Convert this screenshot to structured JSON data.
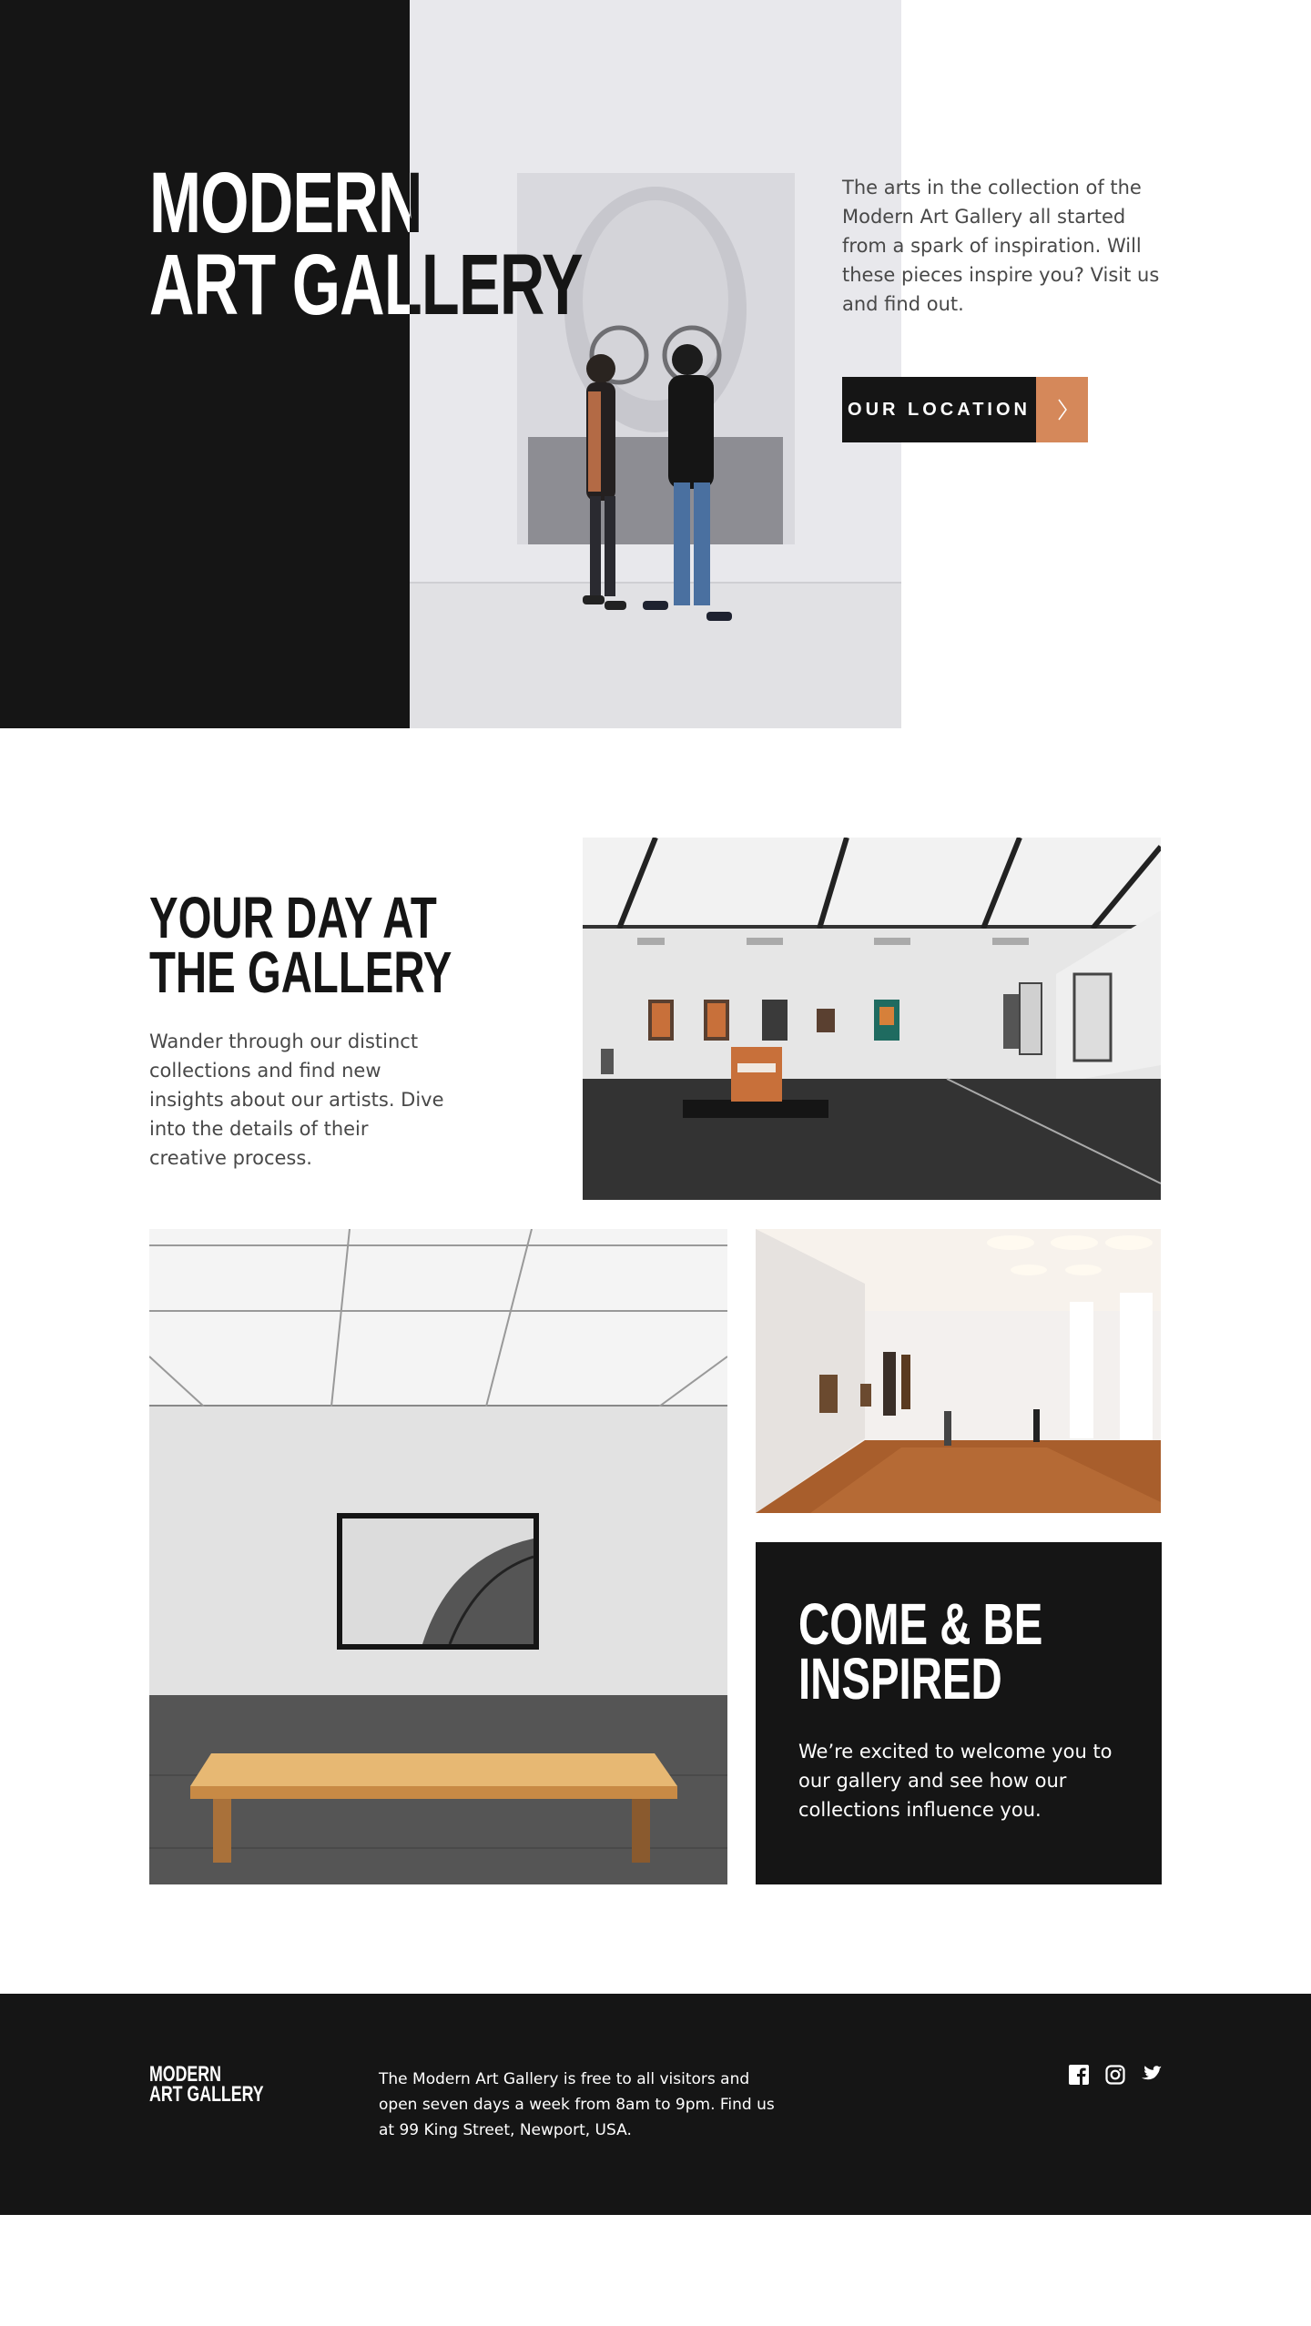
{
  "hero": {
    "title_line1": "Modern",
    "title_line2": "Art Gallery",
    "description": "The arts in the collection of the Modern Art Gallery all started from a spark of inspiration. Will these pieces inspire you? Visit us and find out.",
    "cta_label": "OUR LOCATION",
    "cta_icon": "chevron-right-icon"
  },
  "day_section": {
    "title_line1": "Your day at",
    "title_line2": "the gallery",
    "description": "Wander through our distinct collections and find new insights about our artists. Dive into the details of their creative process."
  },
  "inspired": {
    "title_line1": "Come & be",
    "title_line2": "inspired",
    "description": "We’re excited to welcome you to our gallery and see how our collections influence you."
  },
  "footer": {
    "logo_line1": "Modern",
    "logo_line2": "Art Gallery",
    "info": "The Modern Art Gallery is free to all visitors and open seven days a week from 8am to 9pm. Find us at 99 King Street, Newport, USA.",
    "social_icons": [
      "facebook-icon",
      "instagram-icon",
      "twitter-icon"
    ]
  },
  "colors": {
    "dark": "#151515",
    "accent": "#d5885a",
    "body_text": "#484848",
    "white": "#ffffff"
  }
}
